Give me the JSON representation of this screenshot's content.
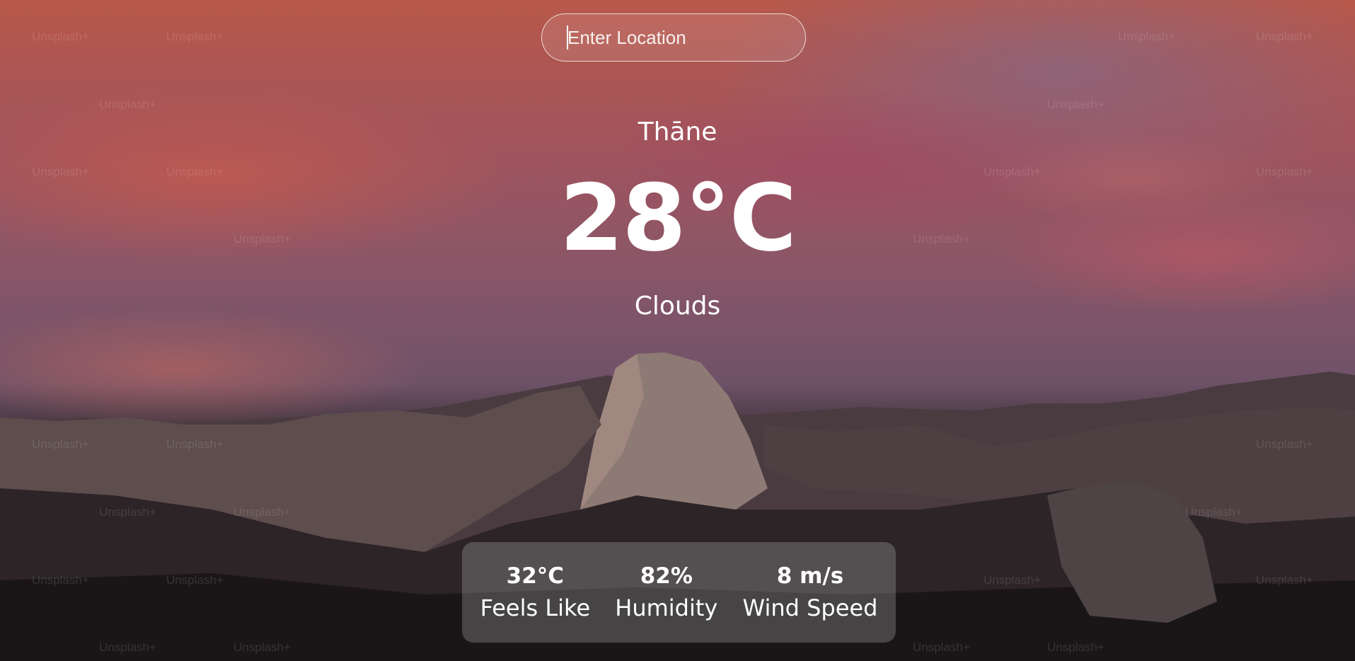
{
  "search": {
    "placeholder": "Enter Location",
    "value": ""
  },
  "weather": {
    "location": "Thāne",
    "temperature": "28°C",
    "condition": "Clouds"
  },
  "stats": [
    {
      "value": "32°C",
      "label": "Feels Like"
    },
    {
      "value": "82%",
      "label": "Humidity"
    },
    {
      "value": "8 m/s",
      "label": "Wind Speed"
    }
  ],
  "background": {
    "watermark_text": "Unsplash+",
    "colors": {
      "sky_top": "#b8584a",
      "sky_mid": "#8b5668",
      "mountain_dark": "#1b1718",
      "stats_panel": "#bebebe"
    }
  }
}
